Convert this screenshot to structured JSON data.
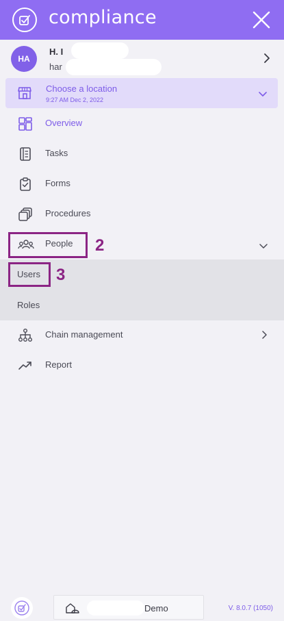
{
  "header": {
    "title": "compliance",
    "logo_icon": "checkbox-logo-icon",
    "close_icon": "close-icon",
    "background": "#8f6df2"
  },
  "user": {
    "initials": "HA",
    "name": "H. I",
    "email": "har"
  },
  "location": {
    "title": "Choose a location",
    "timestamp": "9:27 AM Dec 2, 2022"
  },
  "menu": {
    "overview": "Overview",
    "tasks": "Tasks",
    "forms": "Forms",
    "procedures": "Procedures",
    "people": "People",
    "users": "Users",
    "roles": "Roles",
    "chain_management": "Chain management",
    "report": "Report"
  },
  "annotations": {
    "people_number": "2",
    "users_number": "3",
    "color": "#8b2484"
  },
  "footer": {
    "org_name": "Demo",
    "version": "V. 8.0.7 (1050)"
  },
  "colors": {
    "accent": "#7d5ce8",
    "highlight": "#e2dbfa"
  }
}
